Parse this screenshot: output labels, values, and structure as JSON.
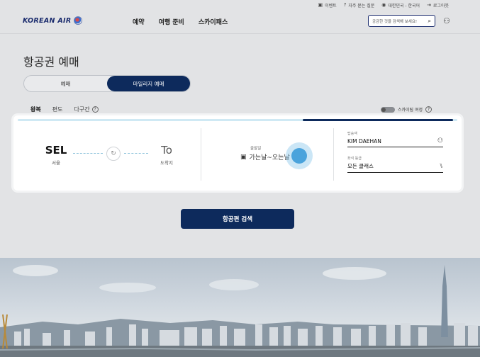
{
  "util": {
    "event": "이벤트",
    "faq": "자주 묻는 질문",
    "region": "대한민국 - 한국어",
    "logout": "로그아웃"
  },
  "header": {
    "logo": "KOREAN AIR",
    "nav": [
      "예약",
      "여행 준비",
      "스카이패스"
    ],
    "search_placeholder": "궁금한 것을 검색해 보세요!"
  },
  "page": {
    "title": "항공권 예매",
    "booking_types": [
      "예매",
      "마일리지 예매"
    ],
    "trip_tabs": [
      "왕복",
      "편도",
      "다구간"
    ],
    "skypass_trip": "스카이팀 여정"
  },
  "search": {
    "origin_code": "SEL",
    "origin_name": "서울",
    "dest_code": "To",
    "dest_name": "도착지",
    "date_label": "출발일",
    "date_value": "가는날~오는날",
    "passenger_label": "탑승객",
    "passenger_value": "KIM DAEHAN",
    "class_label": "좌석 등급",
    "class_value": "모든 클래스",
    "button": "항공편 검색"
  },
  "colors": {
    "brand": "#0d2a5c",
    "accent_red": "#c0142b",
    "highlight": "#4aa3dc"
  }
}
